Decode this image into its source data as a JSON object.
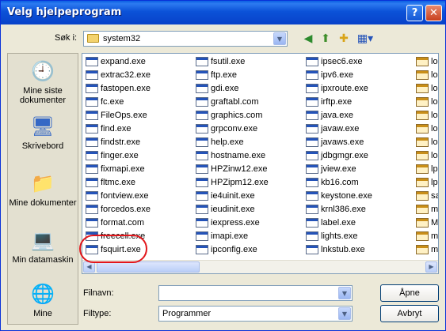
{
  "window": {
    "title": "Velg hjelpeprogram"
  },
  "titlebar": {
    "help_glyph": "?",
    "close_glyph": "✕"
  },
  "lookin": {
    "label": "Søk i:",
    "value": "system32"
  },
  "places": [
    {
      "label": "Mine siste dokumenter",
      "icon": "recent-documents-icon",
      "glyph": "🕘"
    },
    {
      "label": "Skrivebord",
      "icon": "desktop-icon",
      "glyph": "🖥"
    },
    {
      "label": "Mine dokumenter",
      "icon": "my-documents-icon",
      "glyph": "📁"
    },
    {
      "label": "Min datamaskin",
      "icon": "my-computer-icon",
      "glyph": "💻"
    },
    {
      "label": "Mine",
      "icon": "network-places-icon",
      "glyph": "🌐"
    }
  ],
  "files": {
    "col1": [
      "expand.exe",
      "extrac32.exe",
      "fastopen.exe",
      "fc.exe",
      "FileOps.exe",
      "find.exe",
      "findstr.exe",
      "finger.exe",
      "fixmapi.exe",
      "fltmc.exe",
      "fontview.exe",
      "forcedos.exe",
      "format.com",
      "freecell.exe",
      "fsquirt.exe"
    ],
    "col2": [
      "fsutil.exe",
      "ftp.exe",
      "gdi.exe",
      "graftabl.com",
      "graphics.com",
      "grpconv.exe",
      "help.exe",
      "hostname.exe",
      "HPZinw12.exe",
      "HPZipm12.exe",
      "ie4uinit.exe",
      "ieudinit.exe",
      "iexpress.exe",
      "imapi.exe",
      "ipconfig.exe"
    ],
    "col3": [
      "ipsec6.exe",
      "ipv6.exe",
      "ipxroute.exe",
      "irftp.exe",
      "java.exe",
      "javaw.exe",
      "javaws.exe",
      "jdbgmgr.exe",
      "jview.exe",
      "kb16.com",
      "keystone.exe",
      "krnl386.exe",
      "label.exe",
      "lights.exe",
      "lnkstub.exe"
    ],
    "col4": [
      "lo",
      "lo",
      "lo",
      "lo",
      "lo",
      "lo",
      "lo",
      "lo",
      "lp",
      "lp",
      "sa",
      "ma",
      "MA",
      "me",
      "mi"
    ]
  },
  "filename": {
    "label": "Filnavn:",
    "value": ""
  },
  "filetype": {
    "label": "Filtype:",
    "value": "Programmer"
  },
  "buttons": {
    "open": "Åpne",
    "cancel": "Avbryt"
  }
}
